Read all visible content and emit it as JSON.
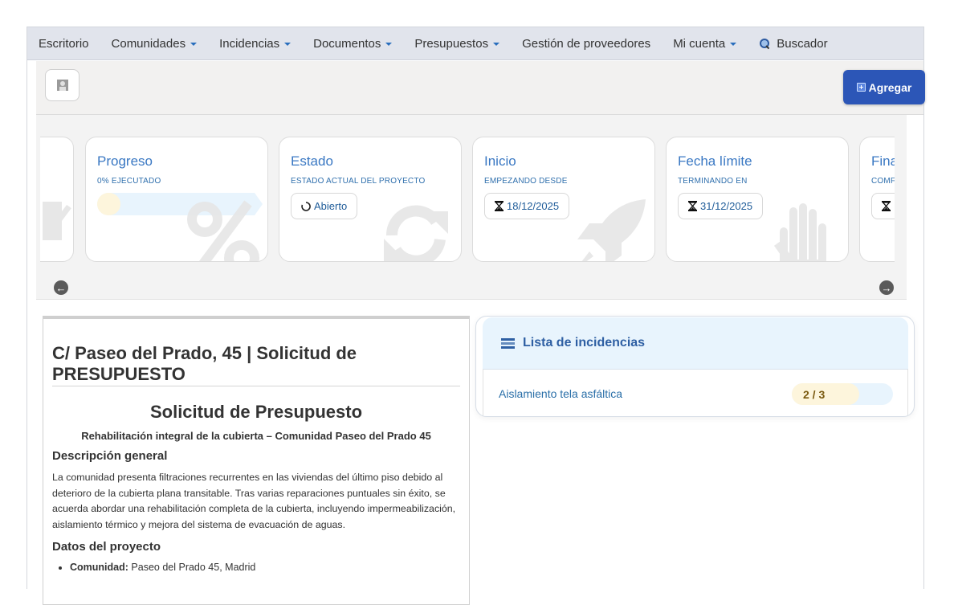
{
  "nav": {
    "items": [
      {
        "label": "Escritorio",
        "dropdown": false
      },
      {
        "label": "Comunidades",
        "dropdown": true
      },
      {
        "label": "Incidencias",
        "dropdown": true
      },
      {
        "label": "Documentos",
        "dropdown": true
      },
      {
        "label": "Presupuestos",
        "dropdown": true
      },
      {
        "label": "Gestión de proveedores",
        "dropdown": false
      },
      {
        "label": "Mi cuenta",
        "dropdown": true
      }
    ],
    "search_label": "Buscador",
    "search_icon": "search-icon"
  },
  "toolbar": {
    "avatar_icon": "user-placeholder-icon",
    "add_label": "Agregar",
    "add_icon": "plus-square-icon"
  },
  "cards": {
    "progreso": {
      "title": "Progreso",
      "subtitle": "0% EJECUTADO",
      "progress_fraction": 0.15,
      "bg_icon": "percent-icon"
    },
    "estado": {
      "title": "Estado",
      "subtitle": "ESTADO ACTUAL DEL PROYECTO",
      "value": "Abierto",
      "value_icon": "circle-notch-icon",
      "bg_icon": "refresh-icon"
    },
    "inicio": {
      "title": "Inicio",
      "subtitle": "EMPEZANDO DESDE",
      "value": "18/12/2025",
      "value_icon": "hourglass-icon",
      "bg_icon": "rocket-icon"
    },
    "fecha_limite": {
      "title": "Fecha límite",
      "subtitle": "TERMINANDO EN",
      "value": "31/12/2025",
      "value_icon": "hourglass-icon",
      "bg_icon": "hand-icon"
    },
    "final": {
      "title": "Fina",
      "subtitle": "COMF",
      "value_icon": "hourglass-icon"
    }
  },
  "carousel": {
    "prev_icon": "arrow-left-circle-icon",
    "next_icon": "arrow-right-circle-icon"
  },
  "document": {
    "heading": "C/ Paseo del Prado, 45 | Solicitud de PRESUPUESTO",
    "title": "Solicitud de Presupuesto",
    "subtitle": "Rehabilitación integral de la cubierta – Comunidad Paseo del Prado 45",
    "section1_title": "Descripción general",
    "section1_text": "La comunidad presenta filtraciones recurrentes en las viviendas del último piso debido al deterioro de la cubierta plana transitable. Tras varias reparaciones puntuales sin éxito, se acuerda abordar una rehabilitación completa de la cubierta, incluyendo impermeabilización, aislamiento térmico y mejora del sistema de evacuación de aguas.",
    "section2_title": "Datos del proyecto",
    "items": [
      {
        "label": "Comunidad:",
        "value": "Paseo del Prado 45, Madrid"
      }
    ]
  },
  "incidencias": {
    "title": "Lista de incidencias",
    "icon": "list-icon",
    "rows": [
      {
        "label": "Aislamiento tela asfáltica",
        "progress_text": "2 / 3",
        "progress_fraction": 0.667
      }
    ]
  },
  "colors": {
    "accent": "#2c56b7",
    "link": "#3a78c3",
    "nav_bg": "#e1e4ec",
    "progress_track": "#e8f4fd",
    "progress_fill": "#fdf5dc"
  }
}
